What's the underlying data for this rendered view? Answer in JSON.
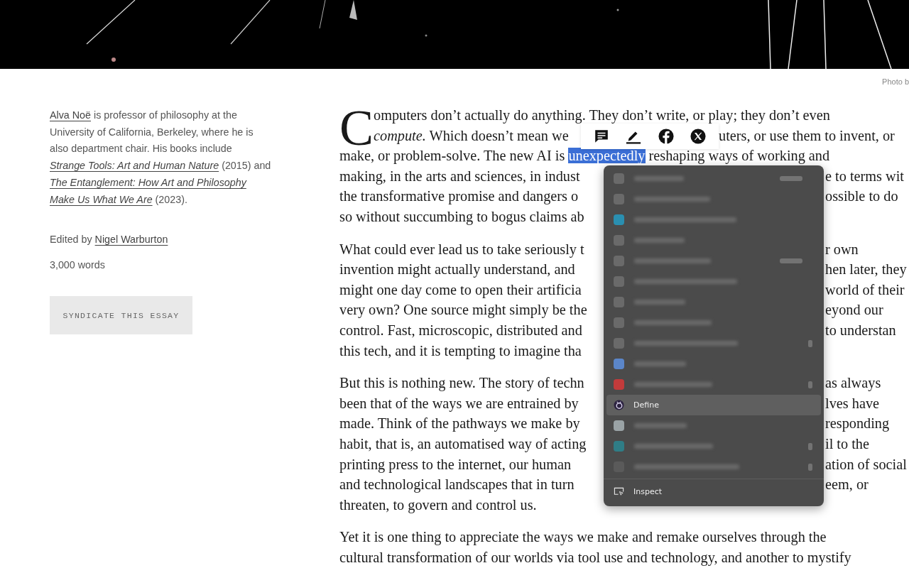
{
  "caption": "Photo b",
  "sidebar": {
    "author_bio": [
      [
        {
          "text": "Alva Noë",
          "kind": "link"
        },
        {
          "text": " is professor of philosophy at the",
          "kind": "text"
        }
      ],
      [
        {
          "text": "University of California, Berkeley, where he is",
          "kind": "text"
        }
      ],
      [
        {
          "text": "also department chair. His books include",
          "kind": "text"
        }
      ],
      [
        {
          "text": "Strange Tools: Art and Human Nature",
          "kind": "book"
        },
        {
          "text": " (2015) and",
          "kind": "text"
        }
      ],
      [
        {
          "text": "The Entanglement: How Art and Philosophy",
          "kind": "book"
        }
      ],
      [
        {
          "text": "Make Us What We Are",
          "kind": "book"
        },
        {
          "text": " (2023).",
          "kind": "text"
        }
      ]
    ],
    "edited_by_label": "Edited by",
    "editor": "Nigel Warburton",
    "word_count": "3,000 words",
    "syndicate_button": "SYNDICATE THIS ESSAY"
  },
  "article": {
    "drop_cap": "C",
    "paragraphs": [
      {
        "lines": [
          {
            "left": "omputers don’t actually do anything. They don’t write, or play; they don’t even"
          },
          {
            "left": "*compute.* Which doesn’t mean we",
            "right": "uters, or use them to invent, or"
          },
          {
            "left": "make, or problem-solve. The new AI is ",
            "highlight": "unexpectedly",
            "right": " reshaping ways of working and"
          },
          {
            "left": "making, in the arts and sciences, in indust",
            "right": "e to terms wit"
          },
          {
            "left": "the transformative promise and dangers o",
            "right": "ossible to do"
          },
          {
            "left": "so without succumbing to bogus claims ab"
          }
        ]
      },
      {
        "lines": [
          {
            "left": "What could ever lead us to take seriously t",
            "right": "r own"
          },
          {
            "left": "invention might actually understand, and",
            "right": "hen later, they"
          },
          {
            "left": "might one day come to open their artificia",
            "right": "world of their"
          },
          {
            "left": "very own? One source might simply be the",
            "right": "eyond our"
          },
          {
            "left": "control. Fast, microscopic, distributed and",
            "right": "to understan"
          },
          {
            "left": "this tech, and it is tempting to imagine tha"
          }
        ]
      },
      {
        "lines": [
          {
            "left": "But this is nothing new. The story of techn",
            "right": "as always"
          },
          {
            "left": "been that of the ways we are entrained by",
            "right": "lves have"
          },
          {
            "left": "made. Think of the pathways we make by",
            "right": "responding"
          },
          {
            "left": "habit, that is, an automatised way of acting",
            "right": "il to the"
          },
          {
            "left": "printing press to the internet, our human",
            "right": "ation of social"
          },
          {
            "left": "and technological landscapes that in turn",
            "right": "eem, or"
          },
          {
            "left": "threaten, to govern and control us."
          }
        ]
      },
      {
        "lines": [
          {
            "left": "Yet it is one thing to appreciate the ways we make and remake ourselves through the"
          },
          {
            "left": "cultural transformation of our worlds via tool use and technology, and another to mystify"
          }
        ]
      }
    ]
  },
  "selection_toolbar": {
    "buttons": [
      {
        "kind": "comment"
      },
      {
        "kind": "highlight"
      },
      {
        "kind": "facebook"
      },
      {
        "kind": "x"
      }
    ]
  },
  "context_menu": {
    "items": [
      {
        "kind": "blurred",
        "color": "#6a6a6a",
        "shortcut": true,
        "submenu": false,
        "selected": false
      },
      {
        "kind": "blurred",
        "color": "#6a6a6a",
        "shortcut": false,
        "submenu": false,
        "selected": false
      },
      {
        "kind": "blurred",
        "color": "#2a8fb0",
        "shortcut": false,
        "submenu": false,
        "selected": false
      },
      {
        "kind": "blurred",
        "color": "#6a6a6a",
        "shortcut": false,
        "submenu": false,
        "selected": false
      },
      {
        "kind": "blurred",
        "color": "#6a6a6a",
        "shortcut": true,
        "submenu": false,
        "selected": false
      },
      {
        "kind": "blurred",
        "color": "#6a6a6a",
        "shortcut": false,
        "submenu": false,
        "selected": false
      },
      {
        "kind": "blurred",
        "color": "#6a6a6a",
        "shortcut": false,
        "submenu": false,
        "selected": false
      },
      {
        "kind": "blurred",
        "color": "#6a6a6a",
        "shortcut": false,
        "submenu": false,
        "selected": false
      },
      {
        "kind": "blurred",
        "color": "#6a6a6a",
        "shortcut": false,
        "submenu": true,
        "selected": false
      },
      {
        "kind": "blurred",
        "color": "#5b86c9",
        "shortcut": false,
        "submenu": false,
        "selected": false
      },
      {
        "kind": "blurred",
        "color": "#c23b3b",
        "shortcut": false,
        "submenu": true,
        "selected": false
      },
      {
        "kind": "app_item",
        "label": "Define",
        "selected": true
      },
      {
        "kind": "blurred",
        "color": "#9aa3a6",
        "shortcut": false,
        "submenu": false,
        "selected": false
      },
      {
        "kind": "blurred",
        "color": "#2f7d86",
        "shortcut": false,
        "submenu": true,
        "selected": false
      },
      {
        "kind": "blurred",
        "color": "#5a5a5a",
        "shortcut": false,
        "submenu": true,
        "selected": false
      },
      {
        "kind": "separator"
      },
      {
        "kind": "tool_item",
        "label": "Inspect",
        "selected": false
      }
    ]
  }
}
